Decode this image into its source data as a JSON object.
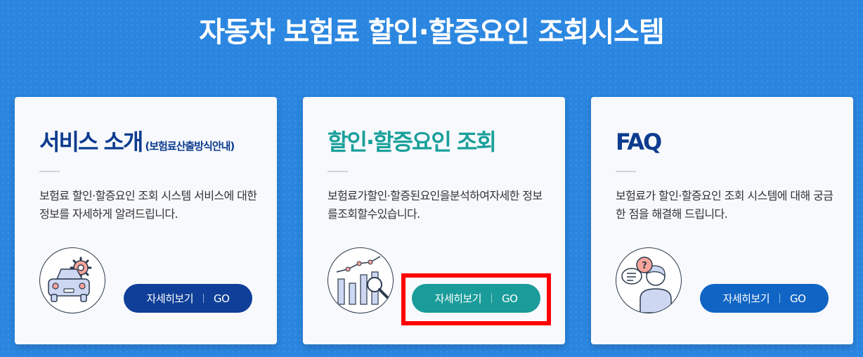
{
  "page": {
    "title": "자동차 보험료 할인·할증요인 조회시스템"
  },
  "cards": [
    {
      "title": "서비스 소개",
      "subtitle": "(보험료산출방식안내)",
      "description": "보험료 할인·할증요인 조회 시스템 서비스에 대한 정보를 자세하게 알려드립니다.",
      "icon": "car-gear-icon",
      "title_color": "#0d3c8f",
      "button": {
        "label": "자세히보기",
        "go": "GO",
        "color": "#0f3f98"
      }
    },
    {
      "title": "할인·할증요인 조회",
      "subtitle": "",
      "description": "보험료가할인·할증된요인을분석하여자세한 정보를조회할수있습니다.",
      "icon": "chart-magnifier-icon",
      "title_color": "#1aa09b",
      "button": {
        "label": "자세히보기",
        "go": "GO",
        "color": "#1a9c9a"
      }
    },
    {
      "title": "FAQ",
      "subtitle": "",
      "description": "보험료가 할인·할증요인 조회 시스템에 대해 궁금한 점을 해결해 드립니다.",
      "icon": "person-question-icon",
      "title_color": "#0d3c8f",
      "button": {
        "label": "자세히보기",
        "go": "GO",
        "color": "#1065c4"
      }
    }
  ],
  "highlight_color": "#ff0000"
}
